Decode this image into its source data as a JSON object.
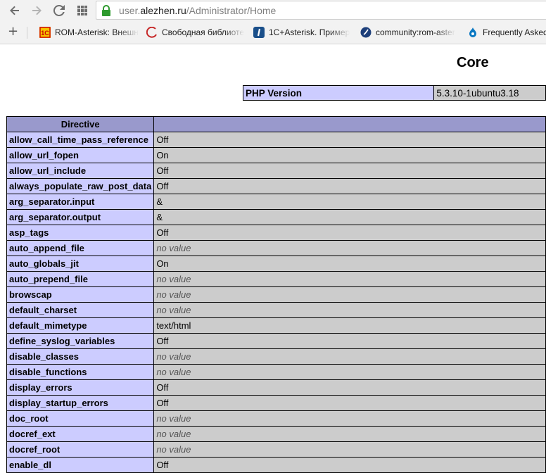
{
  "browser": {
    "url_prefix": "user.",
    "url_domain": "alezhen.ru",
    "url_path": "/Administrator/Home",
    "bookmarks": [
      {
        "label": "ROM-Asterisk: Внешн",
        "icon": "1c-icon"
      },
      {
        "label": "Свободная библиоте",
        "icon": "wikipedia-icon"
      },
      {
        "label": "1С+Asterisk. Пример",
        "icon": "infostart-icon"
      },
      {
        "label": "community:rom-aster",
        "icon": "community-icon"
      },
      {
        "label": "Frequently Asked",
        "icon": "drupal-icon"
      }
    ]
  },
  "page": {
    "title": "Core",
    "version_label": "PHP Version",
    "version_value": "5.3.10-1ubuntu3.18",
    "table_header": {
      "directive": "Directive",
      "value": ""
    },
    "directives": [
      {
        "name": "allow_call_time_pass_reference",
        "value": "Off"
      },
      {
        "name": "allow_url_fopen",
        "value": "On"
      },
      {
        "name": "allow_url_include",
        "value": "Off"
      },
      {
        "name": "always_populate_raw_post_data",
        "value": "Off"
      },
      {
        "name": "arg_separator.input",
        "value": "&"
      },
      {
        "name": "arg_separator.output",
        "value": "&"
      },
      {
        "name": "asp_tags",
        "value": "Off"
      },
      {
        "name": "auto_append_file",
        "value": "no value"
      },
      {
        "name": "auto_globals_jit",
        "value": "On"
      },
      {
        "name": "auto_prepend_file",
        "value": "no value"
      },
      {
        "name": "browscap",
        "value": "no value"
      },
      {
        "name": "default_charset",
        "value": "no value"
      },
      {
        "name": "default_mimetype",
        "value": "text/html"
      },
      {
        "name": "define_syslog_variables",
        "value": "Off"
      },
      {
        "name": "disable_classes",
        "value": "no value"
      },
      {
        "name": "disable_functions",
        "value": "no value"
      },
      {
        "name": "display_errors",
        "value": "Off"
      },
      {
        "name": "display_startup_errors",
        "value": "Off"
      },
      {
        "name": "doc_root",
        "value": "no value"
      },
      {
        "name": "docref_ext",
        "value": "no value"
      },
      {
        "name": "docref_root",
        "value": "no value"
      },
      {
        "name": "enable_dl",
        "value": "Off"
      }
    ]
  }
}
